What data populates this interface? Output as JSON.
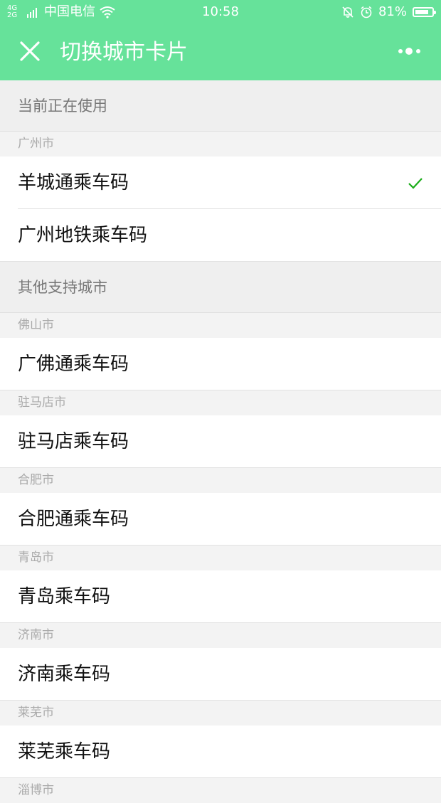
{
  "status": {
    "network": "4G 2G",
    "carrier": "中国电信",
    "time": "10:58",
    "battery_text": "81%",
    "battery_level": 0.81,
    "icons": [
      "signal-icon",
      "wifi-icon",
      "mute-icon",
      "alarm-icon",
      "battery-icon"
    ]
  },
  "nav": {
    "title": "切换城市卡片",
    "close_icon": "close-icon",
    "more_icon": "more-icon"
  },
  "current": {
    "section_label": "当前正在使用",
    "city": "广州市",
    "items": [
      {
        "label": "羊城通乘车码",
        "selected": true
      },
      {
        "label": "广州地铁乘车码",
        "selected": false
      }
    ]
  },
  "others": {
    "section_label": "其他支持城市",
    "cities": [
      {
        "city": "佛山市",
        "item": "广佛通乘车码"
      },
      {
        "city": "驻马店市",
        "item": "驻马店乘车码"
      },
      {
        "city": "合肥市",
        "item": "合肥通乘车码"
      },
      {
        "city": "青岛市",
        "item": "青岛乘车码"
      },
      {
        "city": "济南市",
        "item": "济南乘车码"
      },
      {
        "city": "莱芜市",
        "item": "莱芜乘车码"
      },
      {
        "city": "淄博市",
        "item": ""
      }
    ]
  },
  "colors": {
    "header_bg": "#66e29a",
    "check_green": "#1aad19"
  }
}
